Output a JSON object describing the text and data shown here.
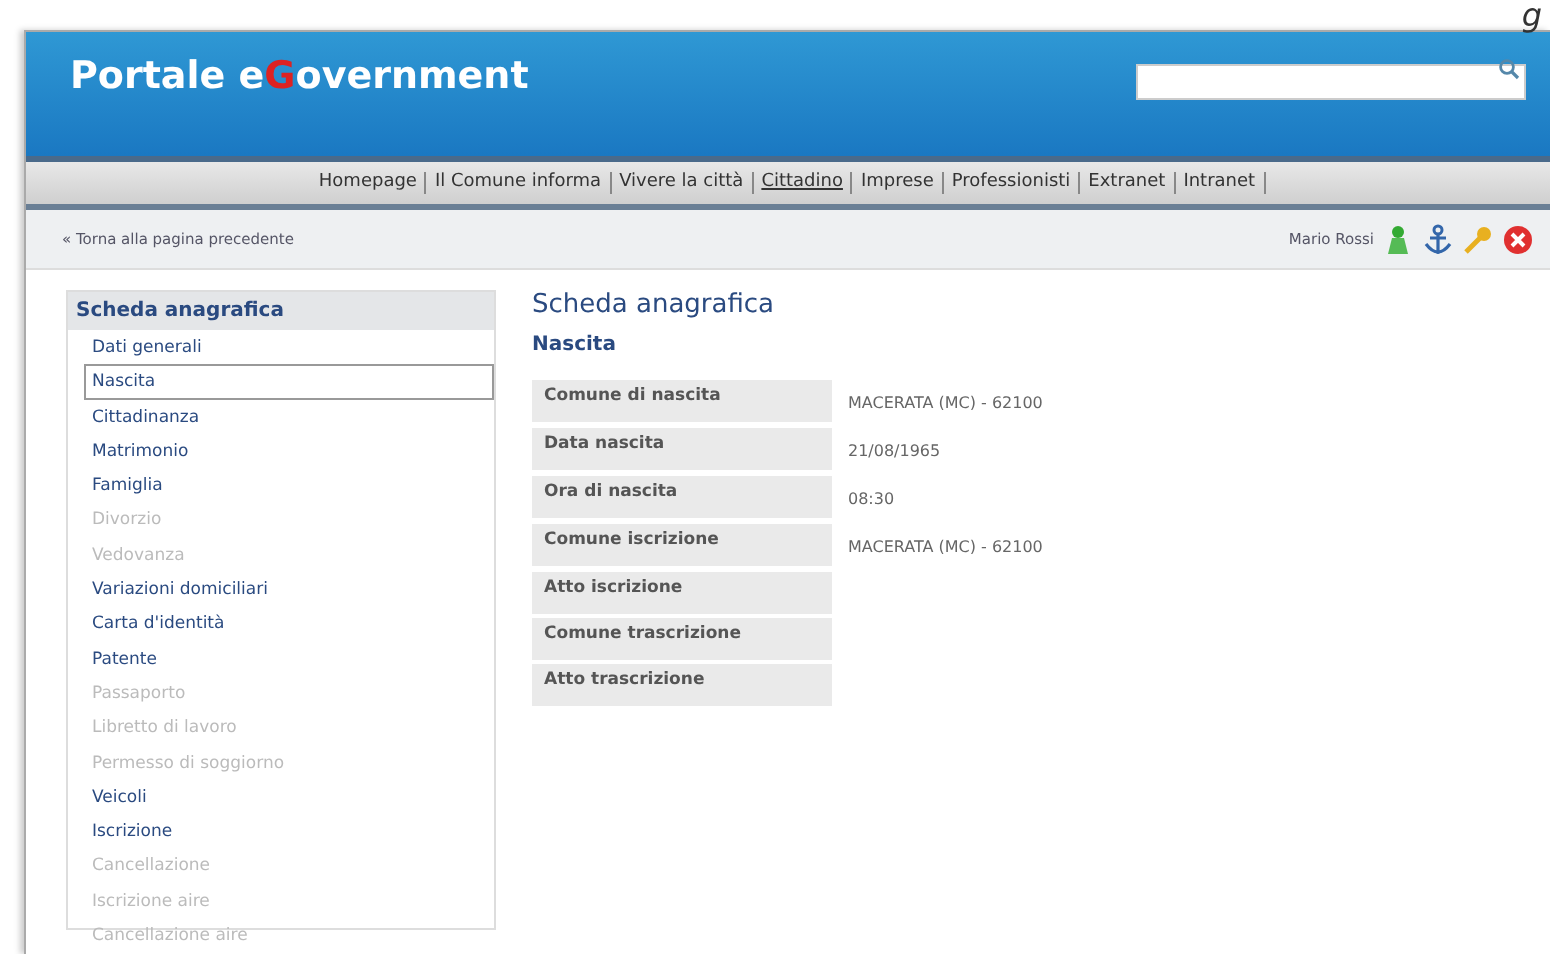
{
  "corner_text": "g",
  "header": {
    "title_parts": [
      {
        "text": "Portale e",
        "accent": false
      },
      {
        "text": "G",
        "accent": true
      },
      {
        "text": "overnment",
        "accent": false
      }
    ]
  },
  "menu": [
    {
      "label": "Homepage",
      "selected": false
    },
    {
      "label": "Il Comune informa",
      "selected": false
    },
    {
      "label": "Vivere la città",
      "selected": false
    },
    {
      "label": "Cittadino",
      "selected": true
    },
    {
      "label": "Imprese",
      "selected": false
    },
    {
      "label": "Professionisti",
      "selected": false
    },
    {
      "label": "Extranet",
      "selected": false
    },
    {
      "label": "Intranet",
      "selected": false
    }
  ],
  "toolbar": {
    "back_link": "« Torna alla pagina precedente",
    "user": "Mario Rossi",
    "icons": [
      {
        "kind": "person"
      },
      {
        "kind": "anchor"
      },
      {
        "kind": "key"
      },
      {
        "kind": "close"
      }
    ]
  },
  "sidebar": {
    "title": "Scheda anagrafica",
    "items": [
      {
        "label": "Dati generali",
        "selected": false,
        "disabled": false
      },
      {
        "label": "Nascita",
        "selected": true,
        "disabled": false
      },
      {
        "label": "Cittadinanza",
        "selected": false,
        "disabled": false
      },
      {
        "label": "Matrimonio",
        "selected": false,
        "disabled": false
      },
      {
        "label": "Famiglia",
        "selected": false,
        "disabled": false
      },
      {
        "label": "Divorzio",
        "selected": false,
        "disabled": true
      },
      {
        "label": "Vedovanza",
        "selected": false,
        "disabled": true
      },
      {
        "label": "Variazioni domiciliari",
        "selected": false,
        "disabled": false
      },
      {
        "label": "Carta d'identità",
        "selected": false,
        "disabled": false
      },
      {
        "label": "Patente",
        "selected": false,
        "disabled": false
      },
      {
        "label": "Passaporto",
        "selected": false,
        "disabled": true
      },
      {
        "label": "Libretto di lavoro",
        "selected": false,
        "disabled": true
      },
      {
        "label": "Permesso di soggiorno",
        "selected": false,
        "disabled": true
      },
      {
        "label": "Veicoli",
        "selected": false,
        "disabled": false
      },
      {
        "label": "Iscrizione",
        "selected": false,
        "disabled": false
      },
      {
        "label": "Cancellazione",
        "selected": false,
        "disabled": true
      },
      {
        "label": "Iscrizione aire",
        "selected": false,
        "disabled": true
      },
      {
        "label": "Cancellazione aire",
        "selected": false,
        "disabled": true
      }
    ]
  },
  "main": {
    "title": "Scheda anagrafica",
    "subtitle": "Nascita",
    "fields": [
      {
        "label": "Comune di nascita",
        "value": "MACERATA (MC) - 62100"
      },
      {
        "label": "Data nascita",
        "value": "21/08/1965"
      },
      {
        "label": "Ora di nascita",
        "value": "08:30"
      },
      {
        "label": "Comune iscrizione",
        "value": "MACERATA (MC) - 62100"
      },
      {
        "label": "Atto iscrizione"
      },
      {
        "label": "Comune trascrizione"
      },
      {
        "label": "Atto trascrizione"
      }
    ]
  }
}
